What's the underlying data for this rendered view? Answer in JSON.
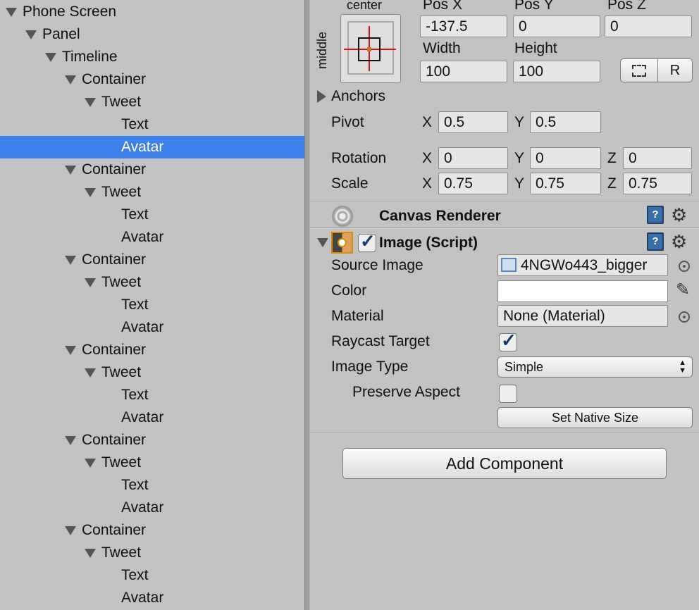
{
  "hierarchy": {
    "items": [
      {
        "label": "Phone Screen",
        "depth": 0,
        "expanded": true
      },
      {
        "label": "Panel",
        "depth": 1,
        "expanded": true
      },
      {
        "label": "Timeline",
        "depth": 2,
        "expanded": true
      },
      {
        "label": "Container",
        "depth": 3,
        "expanded": true
      },
      {
        "label": "Tweet",
        "depth": 4,
        "expanded": true
      },
      {
        "label": "Text",
        "depth": 5
      },
      {
        "label": "Avatar",
        "depth": 5,
        "selected": true
      },
      {
        "label": "Container",
        "depth": 3,
        "expanded": true
      },
      {
        "label": "Tweet",
        "depth": 4,
        "expanded": true
      },
      {
        "label": "Text",
        "depth": 5
      },
      {
        "label": "Avatar",
        "depth": 5
      },
      {
        "label": "Container",
        "depth": 3,
        "expanded": true
      },
      {
        "label": "Tweet",
        "depth": 4,
        "expanded": true
      },
      {
        "label": "Text",
        "depth": 5
      },
      {
        "label": "Avatar",
        "depth": 5
      },
      {
        "label": "Container",
        "depth": 3,
        "expanded": true
      },
      {
        "label": "Tweet",
        "depth": 4,
        "expanded": true
      },
      {
        "label": "Text",
        "depth": 5
      },
      {
        "label": "Avatar",
        "depth": 5
      },
      {
        "label": "Container",
        "depth": 3,
        "expanded": true
      },
      {
        "label": "Tweet",
        "depth": 4,
        "expanded": true
      },
      {
        "label": "Text",
        "depth": 5
      },
      {
        "label": "Avatar",
        "depth": 5
      },
      {
        "label": "Container",
        "depth": 3,
        "expanded": true
      },
      {
        "label": "Tweet",
        "depth": 4,
        "expanded": true
      },
      {
        "label": "Text",
        "depth": 5
      },
      {
        "label": "Avatar",
        "depth": 5
      }
    ],
    "selected_color": "#3d80ea"
  },
  "rect_transform": {
    "anchor_preset_h": "center",
    "anchor_preset_v": "middle",
    "pos_x_label": "Pos X",
    "pos_y_label": "Pos Y",
    "pos_z_label": "Pos Z",
    "pos_x": "-137.5",
    "pos_y": "0",
    "pos_z": "0",
    "width_label": "Width",
    "height_label": "Height",
    "width": "100",
    "height": "100",
    "raw_edit_label": "R",
    "anchors_label": "Anchors",
    "pivot_label": "Pivot",
    "pivot_x": "0.5",
    "pivot_y": "0.5",
    "rotation_label": "Rotation",
    "rotation_x": "0",
    "rotation_y": "0",
    "rotation_z": "0",
    "scale_label": "Scale",
    "scale_x": "0.75",
    "scale_y": "0.75",
    "scale_z": "0.75",
    "axis_x": "X",
    "axis_y": "Y",
    "axis_z": "Z"
  },
  "canvas_renderer": {
    "title": "Canvas Renderer"
  },
  "image_script": {
    "title": "Image (Script)",
    "enabled": true,
    "source_image_label": "Source Image",
    "source_image_value": "4NGWo443_bigger",
    "color_label": "Color",
    "color_value": "#ffffff",
    "material_label": "Material",
    "material_value": "None (Material)",
    "raycast_label": "Raycast Target",
    "raycast_checked": true,
    "image_type_label": "Image Type",
    "image_type_value": "Simple",
    "preserve_aspect_label": "Preserve Aspect",
    "preserve_aspect_checked": false,
    "set_native_size_label": "Set Native Size"
  },
  "add_component_label": "Add Component",
  "icons": {
    "help": "help-book-icon",
    "settings": "gear-icon",
    "picker": "object-picker-icon",
    "eyedropper": "eyedropper-icon"
  }
}
